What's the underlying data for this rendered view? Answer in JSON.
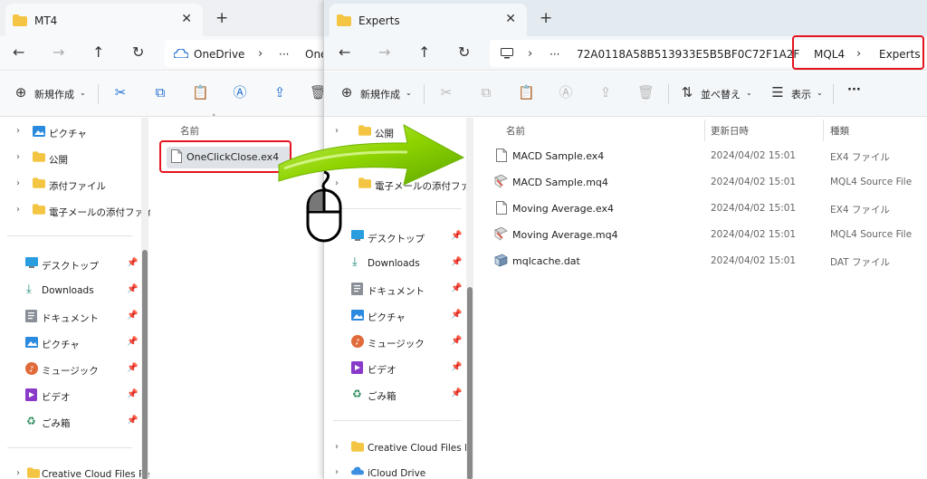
{
  "left_window": {
    "tab_title": "MT4",
    "address": {
      "crumbs": [
        "OneDrive",
        "···",
        "One"
      ]
    },
    "toolbar": {
      "new_label": "新規作成"
    },
    "nav_items": [
      {
        "label": "ピクチャ",
        "icon": "pictures-folder-icon"
      },
      {
        "label": "公開",
        "icon": "folder-icon"
      },
      {
        "label": "添付ファイル",
        "icon": "folder-icon"
      },
      {
        "label": "電子メールの添付ファイ",
        "icon": "folder-icon"
      }
    ],
    "quick_access": [
      {
        "label": "デスクトップ",
        "icon": "desktop-icon"
      },
      {
        "label": "Downloads",
        "icon": "download-icon"
      },
      {
        "label": "ドキュメント",
        "icon": "documents-icon"
      },
      {
        "label": "ピクチャ",
        "icon": "pictures-icon"
      },
      {
        "label": "ミュージック",
        "icon": "music-icon"
      },
      {
        "label": "ビデオ",
        "icon": "video-icon"
      },
      {
        "label": "ごみ箱",
        "icon": "recycle-bin-icon"
      }
    ],
    "bottom_item": "Creative Cloud Files Pe",
    "column_name": "名前",
    "files": [
      {
        "name": "OneClickClose.ex4",
        "icon": "file-icon"
      }
    ]
  },
  "right_window": {
    "tab_title": "Experts",
    "address": {
      "crumbs": [
        "···",
        "72A0118A58B513933E5B5BF0C72F1A2F",
        "MQL4",
        "Experts"
      ]
    },
    "toolbar": {
      "new_label": "新規作成",
      "sort_label": "並べ替え",
      "view_label": "表示",
      "more_label": "···"
    },
    "nav_items": [
      {
        "label": "公開",
        "icon": "folder-icon"
      },
      {
        "label": "電子メールの添付ファイ",
        "icon": "folder-icon"
      }
    ],
    "quick_access": [
      {
        "label": "デスクトップ",
        "icon": "desktop-icon"
      },
      {
        "label": "Downloads",
        "icon": "download-icon"
      },
      {
        "label": "ドキュメント",
        "icon": "documents-icon"
      },
      {
        "label": "ピクチャ",
        "icon": "pictures-icon"
      },
      {
        "label": "ミュージック",
        "icon": "music-icon"
      },
      {
        "label": "ビデオ",
        "icon": "video-icon"
      },
      {
        "label": "ごみ箱",
        "icon": "recycle-bin-icon"
      }
    ],
    "bottom_items": [
      "Creative Cloud Files Pe",
      "iCloud Drive"
    ],
    "columns": {
      "name": "名前",
      "date": "更新日時",
      "type": "種類"
    },
    "files": [
      {
        "name": "MACD Sample.ex4",
        "date": "2024/04/02 15:01",
        "type": "EX4 ファイル",
        "icon": "file-icon"
      },
      {
        "name": "MACD Sample.mq4",
        "date": "2024/04/02 15:01",
        "type": "MQL4 Source File",
        "icon": "mq4-file-icon"
      },
      {
        "name": "Moving Average.ex4",
        "date": "2024/04/02 15:01",
        "type": "EX4 ファイル",
        "icon": "file-icon"
      },
      {
        "name": "Moving Average.mq4",
        "date": "2024/04/02 15:01",
        "type": "MQL4 Source File",
        "icon": "mq4-file-icon"
      },
      {
        "name": "mqlcache.dat",
        "date": "2024/04/02 15:01",
        "type": "DAT ファイル",
        "icon": "dat-file-icon"
      }
    ]
  },
  "colors": {
    "highlight": "#e5141f",
    "arrow_green": "#8fd400",
    "folder_yellow": "#f4c542",
    "accent_blue": "#1f6fd0"
  }
}
